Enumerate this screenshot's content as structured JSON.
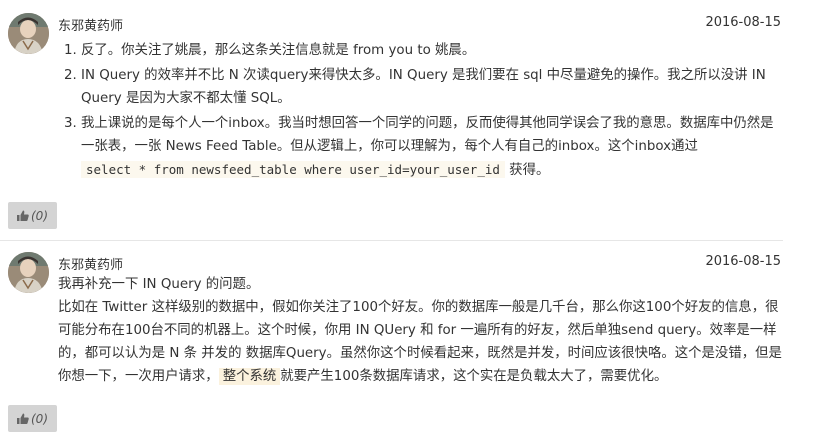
{
  "comments": [
    {
      "author": "东邪黄药师",
      "date": "2016-08-15",
      "items": [
        "反了。你关注了姚晨，那么这条关注信息就是 from you to 姚晨。",
        "IN Query 的效率并不比 N 次读query来得快太多。IN Query 是我们要在 sql 中尽量避免的操作。我之所以没讲 IN Query 是因为大家不都太懂 SQL。",
        "我上课说的是每个人一个inbox。我当时想回答一个同学的问题，反而使得其他同学误会了我的意思。数据库中仍然是一张表，一张 News Feed Table。但从逻辑上，你可以理解为，每个人有自己的inbox。这个inbox通过"
      ],
      "code": "select * from newsfeed_table where user_id=your_user_id",
      "code_suffix": " 获得。",
      "like_count": "(0)"
    },
    {
      "author": "东邪黄药师",
      "date": "2016-08-15",
      "line1": "我再补充一下 IN Query 的问题。",
      "para_before": "比如在 Twitter 这样级别的数据中，假如你关注了100个好友。你的数据库一般是几千台，那么你这100个好友的信息，很可能分布在100台不同的机器上。这个时候，你用 IN QUery 和 for 一遍所有的好友，然后单独send query。效率是一样的，都可以认为是 N 条 并发的 数据库Query。虽然你这个时候看起来，既然是并发，时间应该很快咯。这个是没错，但是你想一下，一次用户请求，",
      "highlight": "整个系统",
      "para_after": "就要产生100条数据库请求，这个实在是负载太大了，需要优化。",
      "like_count": "(0)"
    }
  ],
  "icons": {
    "like": "thumbs-up-icon"
  }
}
